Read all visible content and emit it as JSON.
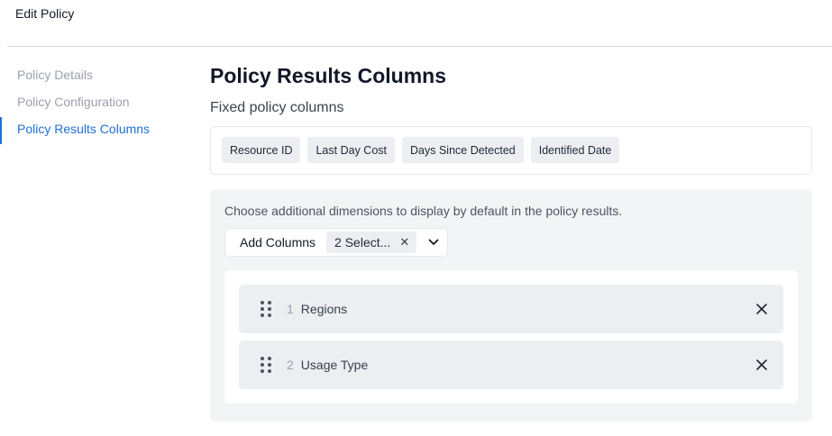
{
  "header": {
    "title": "Edit Policy"
  },
  "sidebar": {
    "items": [
      {
        "label": "Policy Details"
      },
      {
        "label": "Policy Configuration"
      },
      {
        "label": "Policy Results Columns"
      }
    ],
    "active": "Policy Results Columns"
  },
  "main": {
    "title": "Policy Results Columns",
    "fixed_title": "Fixed policy columns",
    "fixed_columns": [
      "Resource ID",
      "Last Day Cost",
      "Days Since Detected",
      "Identified Date"
    ],
    "description": "Choose additional dimensions to display by default in the policy results.",
    "add_columns": {
      "label": "Add Columns",
      "selected_text": "2 Select...",
      "clear_icon": "close-icon",
      "dropdown_icon": "chevron-down-icon"
    },
    "selected_columns": [
      {
        "index": "1",
        "name": "Regions"
      },
      {
        "index": "2",
        "name": "Usage Type"
      }
    ]
  },
  "colors": {
    "accent": "#1f6fd6",
    "panel": "#f3f4f6",
    "chip": "#eceef1"
  }
}
